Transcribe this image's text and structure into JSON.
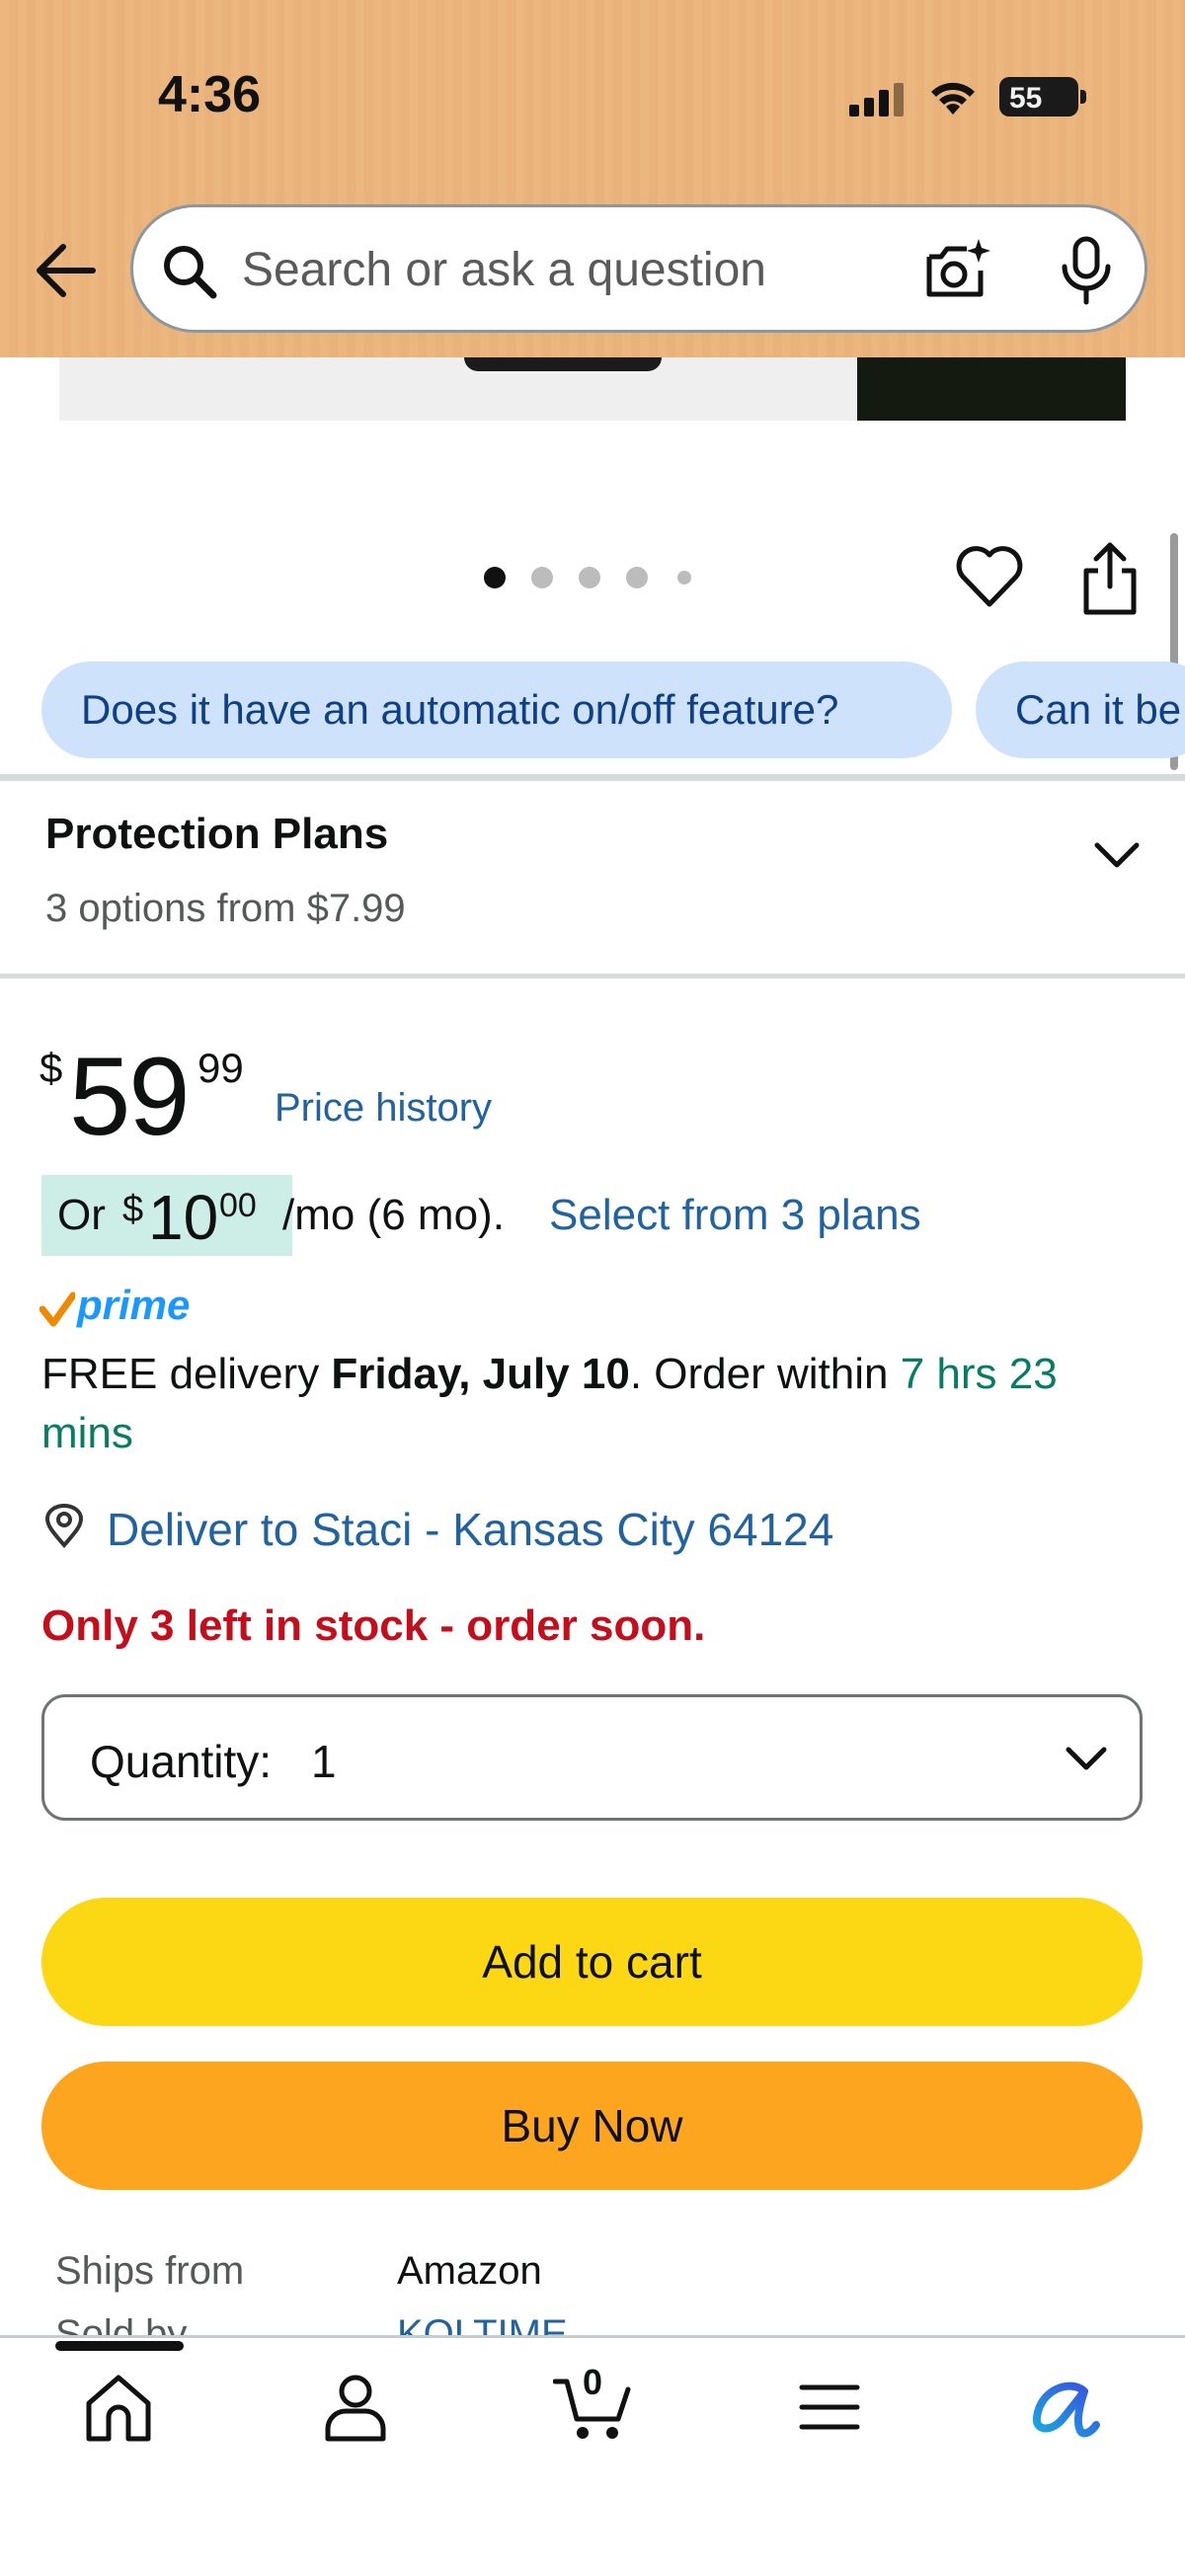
{
  "status_bar": {
    "time": "4:36",
    "battery": "55"
  },
  "search": {
    "placeholder": "Search or ask a question"
  },
  "gallery": {
    "dot_count": 5,
    "active_dot": 1
  },
  "chips": [
    "Does it have an automatic on/off feature?",
    "Can it be"
  ],
  "protection_plans": {
    "title": "Protection Plans",
    "subtitle": "3 options from $7.99"
  },
  "price": {
    "symbol": "$",
    "whole": "59",
    "fraction": "99",
    "history_link": "Price history"
  },
  "installment": {
    "prefix": "Or",
    "symbol": "$",
    "whole": "10",
    "fraction": "00",
    "term": "/mo (6 mo).",
    "link": "Select from 3 plans"
  },
  "prime": {
    "label": "prime"
  },
  "delivery": {
    "prefix": "FREE delivery ",
    "date": "Friday, July 10",
    "middle": ". Order within ",
    "countdown": "7 hrs 23 mins"
  },
  "location": {
    "label": "Deliver to Staci - Kansas City 64124"
  },
  "stock": {
    "label": "Only 3 left in stock - order soon."
  },
  "quantity": {
    "label": "Quantity:",
    "value": "1"
  },
  "buttons": {
    "add_to_cart": "Add to cart",
    "buy_now": "Buy Now"
  },
  "seller": {
    "ships_from_label": "Ships from",
    "ships_from_value": "Amazon",
    "sold_by_label": "Sold by",
    "sold_by_value": "KOLTIME"
  },
  "bottom_nav": {
    "cart_count": "0"
  },
  "colors": {
    "header": "#ebb77e",
    "link": "#2162a1",
    "add_to_cart": "#fcd714",
    "buy_now": "#fea520",
    "stock_warning": "#c40e1c",
    "countdown": "#067d62",
    "chip": "#cfe2fb"
  }
}
